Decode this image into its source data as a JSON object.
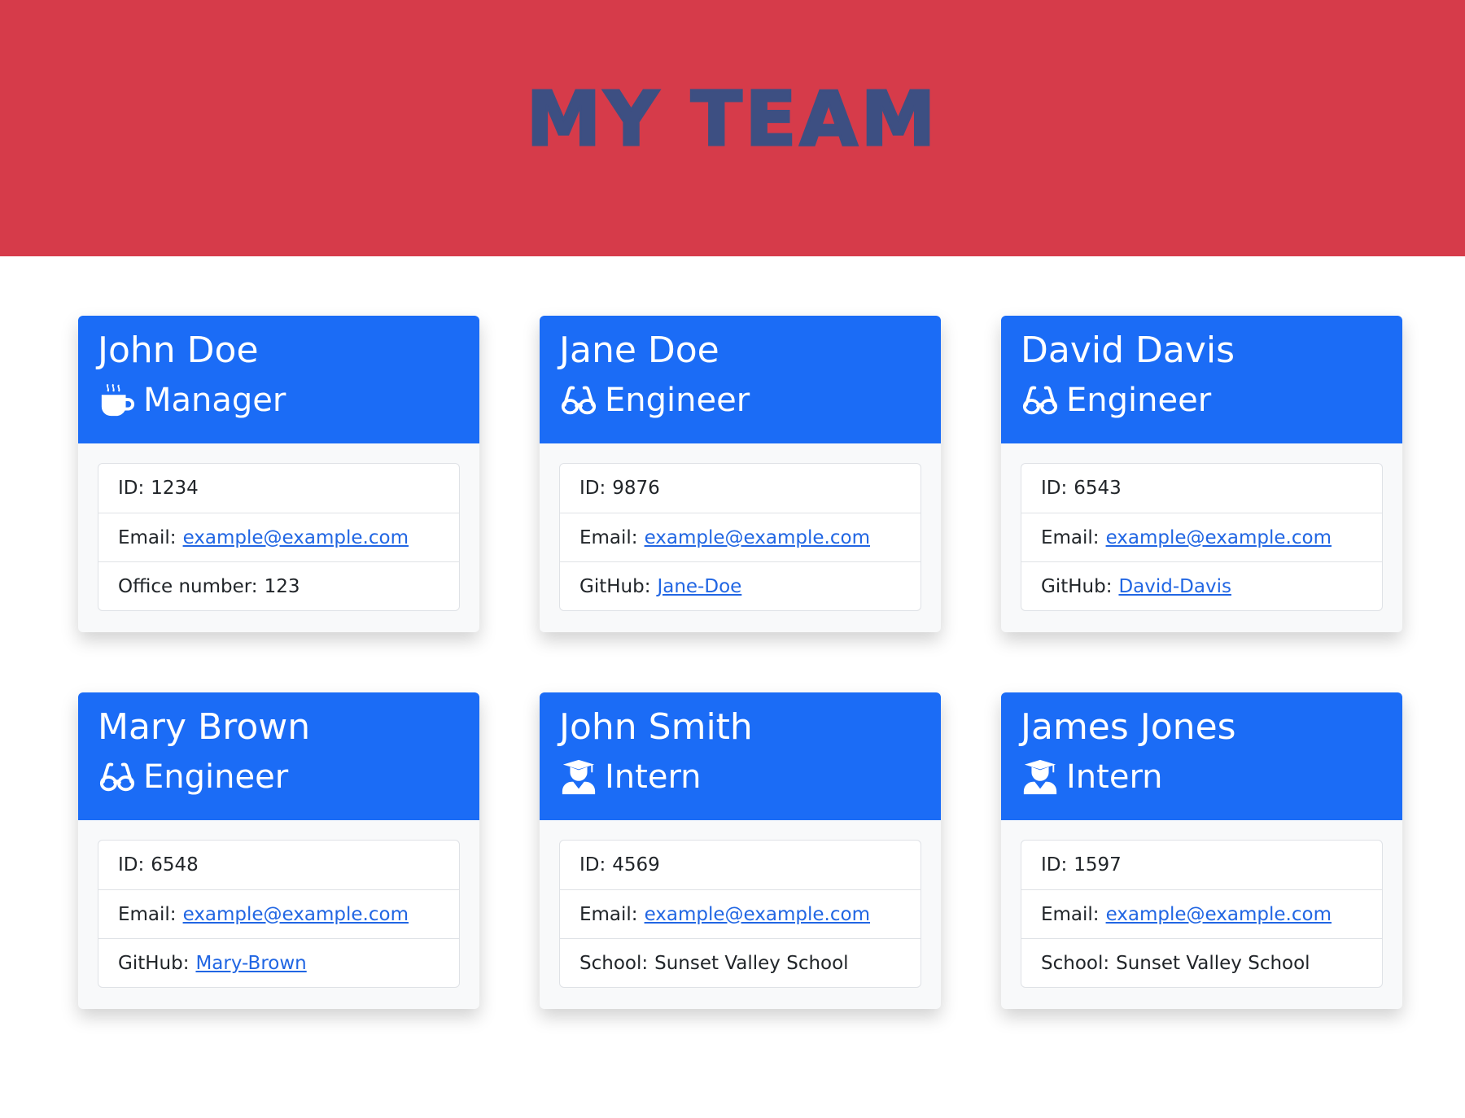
{
  "header": {
    "title": "My Team"
  },
  "colors": {
    "hero_background": "#d63b4a",
    "title_color": "#3d4f82",
    "card_header": "#1b6cf6",
    "link": "#2166e3"
  },
  "employees": [
    {
      "name": "John Doe",
      "role": "Manager",
      "icon": "mug-hot-icon",
      "id_label": "ID:",
      "id": "1234",
      "email_label": "Email:",
      "email": "example@example.com",
      "extra_label": "Office number:",
      "extra": "123"
    },
    {
      "name": "Jane Doe",
      "role": "Engineer",
      "icon": "glasses-icon",
      "id_label": "ID:",
      "id": "9876",
      "email_label": "Email:",
      "email": "example@example.com",
      "extra_label": "GitHub:",
      "extra": "Jane-Doe"
    },
    {
      "name": "David Davis",
      "role": "Engineer",
      "icon": "glasses-icon",
      "id_label": "ID:",
      "id": "6543",
      "email_label": "Email:",
      "email": "example@example.com",
      "extra_label": "GitHub:",
      "extra": "David-Davis"
    },
    {
      "name": "Mary Brown",
      "role": "Engineer",
      "icon": "glasses-icon",
      "id_label": "ID:",
      "id": "6548",
      "email_label": "Email:",
      "email": "example@example.com",
      "extra_label": "GitHub:",
      "extra": "Mary-Brown"
    },
    {
      "name": "John Smith",
      "role": "Intern",
      "icon": "user-graduate-icon",
      "id_label": "ID:",
      "id": "4569",
      "email_label": "Email:",
      "email": "example@example.com",
      "extra_label": "School:",
      "extra": "Sunset Valley School"
    },
    {
      "name": "James Jones",
      "role": "Intern",
      "icon": "user-graduate-icon",
      "id_label": "ID:",
      "id": "1597",
      "email_label": "Email:",
      "email": "example@example.com",
      "extra_label": "School:",
      "extra": "Sunset Valley School"
    }
  ]
}
